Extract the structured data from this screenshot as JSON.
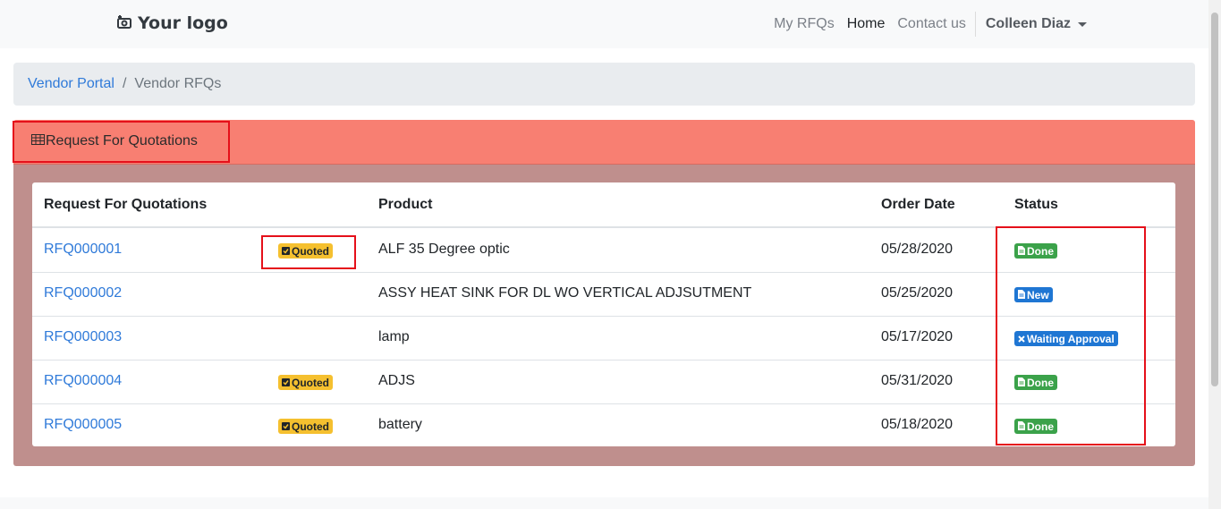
{
  "brand": {
    "logo_text": "Your logo"
  },
  "nav": {
    "links": [
      "My RFQs",
      "Home",
      "Contact us"
    ],
    "user": "Colleen Diaz"
  },
  "breadcrumb": {
    "parent": "Vendor Portal",
    "current": "Vendor RFQs"
  },
  "card": {
    "title": "Request For Quotations"
  },
  "table": {
    "headers": {
      "rfq": "Request For Quotations",
      "product": "Product",
      "order_date": "Order Date",
      "status": "Status"
    },
    "rows": [
      {
        "rfq": "RFQ000001",
        "quoted": "Quoted",
        "product": "ALF 35 Degree optic",
        "order_date": "05/28/2020",
        "status": "Done"
      },
      {
        "rfq": "RFQ000002",
        "quoted": "",
        "product": "ASSY HEAT SINK FOR DL WO VERTICAL ADJSUTMENT",
        "order_date": "05/25/2020",
        "status": "New"
      },
      {
        "rfq": "RFQ000003",
        "quoted": "",
        "product": "lamp",
        "order_date": "05/17/2020",
        "status": "Waiting Approval"
      },
      {
        "rfq": "RFQ000004",
        "quoted": "Quoted",
        "product": "ADJS",
        "order_date": "05/31/2020",
        "status": "Done"
      },
      {
        "rfq": "RFQ000005",
        "quoted": "Quoted",
        "product": "battery",
        "order_date": "05/18/2020",
        "status": "Done"
      }
    ]
  },
  "colors": {
    "card_header": "#f87f72",
    "card_body": "#bf8f8d",
    "link": "#2f7ad9",
    "badge_quoted": "#f5c02f",
    "badge_done": "#3ba24a",
    "badge_new": "#1f76d3",
    "highlight": "#e5101a"
  },
  "icons": {
    "logo": "camera-icon",
    "card_title": "table-icon",
    "quoted": "check-square-icon",
    "done": "file-icon",
    "new": "file-icon",
    "waiting": "x-icon",
    "user_menu": "caret-down-icon"
  }
}
